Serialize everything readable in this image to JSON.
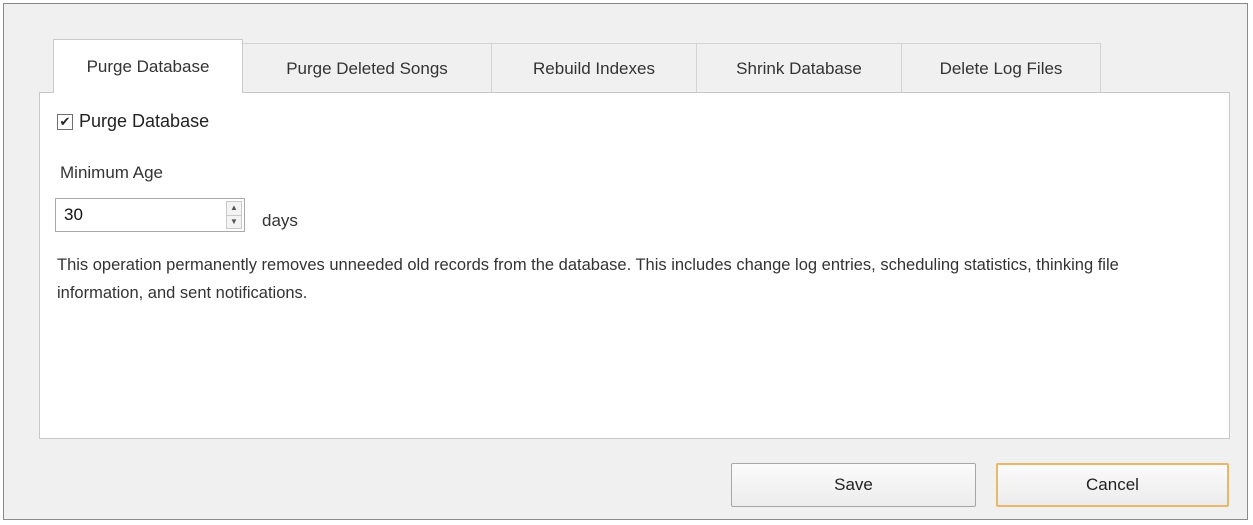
{
  "tabs": [
    {
      "label": "Purge Database",
      "active": true
    },
    {
      "label": "Purge Deleted Songs",
      "active": false
    },
    {
      "label": "Rebuild Indexes",
      "active": false
    },
    {
      "label": "Shrink Database",
      "active": false
    },
    {
      "label": "Delete Log Files",
      "active": false
    }
  ],
  "purge": {
    "checkbox_label": "Purge Database",
    "checkbox_checked": true,
    "check_glyph": "✔",
    "min_age_label": "Minimum Age",
    "min_age_value": "30",
    "spin_up_glyph": "▲",
    "spin_down_glyph": "▼",
    "units_label": "days",
    "description": "This operation permanently removes unneeded old records from the database. This includes change log entries, scheduling statistics, thinking file information, and sent notifications."
  },
  "buttons": {
    "save_label": "Save",
    "cancel_label": "Cancel"
  },
  "colors": {
    "dialog_bg": "#f0f0f0",
    "panel_bg": "#ffffff",
    "focus_border": "#e8b86a"
  }
}
